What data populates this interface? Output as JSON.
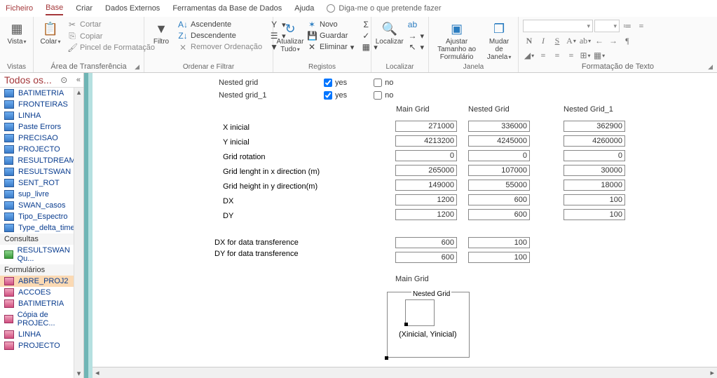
{
  "tabs": {
    "file": "Ficheiro",
    "home": "Base",
    "create": "Criar",
    "external": "Dados Externos",
    "dbtools": "Ferramentas da Base de Dados",
    "help": "Ajuda",
    "tell": "Diga-me o que pretende fazer"
  },
  "ribbon": {
    "views": {
      "view": "Vista",
      "group": "Vistas"
    },
    "clipboard": {
      "paste": "Colar",
      "cut": "Cortar",
      "copy": "Copiar",
      "painter": "Pincel de Formatação",
      "group": "Área de Transferência"
    },
    "sortfilter": {
      "filter": "Filtro",
      "asc": "Ascendente",
      "desc": "Descendente",
      "remove": "Remover Ordenação",
      "group": "Ordenar e Filtrar"
    },
    "records": {
      "refresh": "Atualizar Tudo",
      "new": "Novo",
      "save": "Guardar",
      "delete": "Eliminar",
      "group": "Registos"
    },
    "find": {
      "find": "Localizar",
      "group": "Localizar"
    },
    "window": {
      "fit": "Ajustar Tamanho ao Formulário",
      "switch": "Mudar de Janela",
      "group": "Janela"
    },
    "format": {
      "group": "Formatação de Texto"
    }
  },
  "nav": {
    "title": "Todos os...",
    "tables": [
      "BATIMETRIA",
      "FRONTEIRAS",
      "LINHA",
      "Paste Errors",
      "PRECISAO",
      "PROJECTO",
      "RESULTDREAMS",
      "RESULTSWAN",
      "SENT_ROT",
      "sup_livre",
      "SWAN_casos",
      "Tipo_Espectro",
      "Type_delta_time"
    ],
    "queries_label": "Consultas",
    "queries": [
      "RESULTSWAN Qu..."
    ],
    "forms_label": "Formulários",
    "forms": [
      "ABRE_PROJ2",
      "ACCOES",
      "BATIMETRIA",
      "Cópia de PROJEC...",
      "LINHA",
      "PROJECTO"
    ]
  },
  "form": {
    "nested_grid": "Nested grid",
    "nested_grid_1": "Nested grid_1",
    "yes": "yes",
    "no": "no",
    "cols": {
      "main": "Main Grid",
      "nested": "Nested Grid",
      "nested1": "Nested Grid_1"
    },
    "labels": {
      "xinit": "X inicial",
      "yinit": "Y inicial",
      "rot": "Grid rotation",
      "lenx": "Grid lenght in x direction  (m)",
      "leny": "Grid height in y direction(m)",
      "dx": "DX",
      "dy": "DY",
      "dxtrans": "DX for data transference",
      "dytrans": "DY for data transference"
    },
    "main": {
      "xinit": "271000",
      "yinit": "4213200",
      "rot": "0",
      "lenx": "265000",
      "leny": "149000",
      "dx": "1200",
      "dy": "1200"
    },
    "nested": {
      "xinit": "336000",
      "yinit": "4245000",
      "rot": "0",
      "lenx": "107000",
      "leny": "55000",
      "dx": "600",
      "dy": "600"
    },
    "nested1": {
      "xinit": "362900",
      "yinit": "4260000",
      "rot": "0",
      "lenx": "30000",
      "leny": "18000",
      "dx": "100",
      "dy": "100"
    },
    "trans": {
      "dx_m": "600",
      "dy_m": "600",
      "dx_n": "100",
      "dy_n": "100"
    },
    "diag": {
      "outer": "Main Grid",
      "inner": "Nested Grid",
      "origin": "(Xinicial, Yinicial)"
    }
  }
}
